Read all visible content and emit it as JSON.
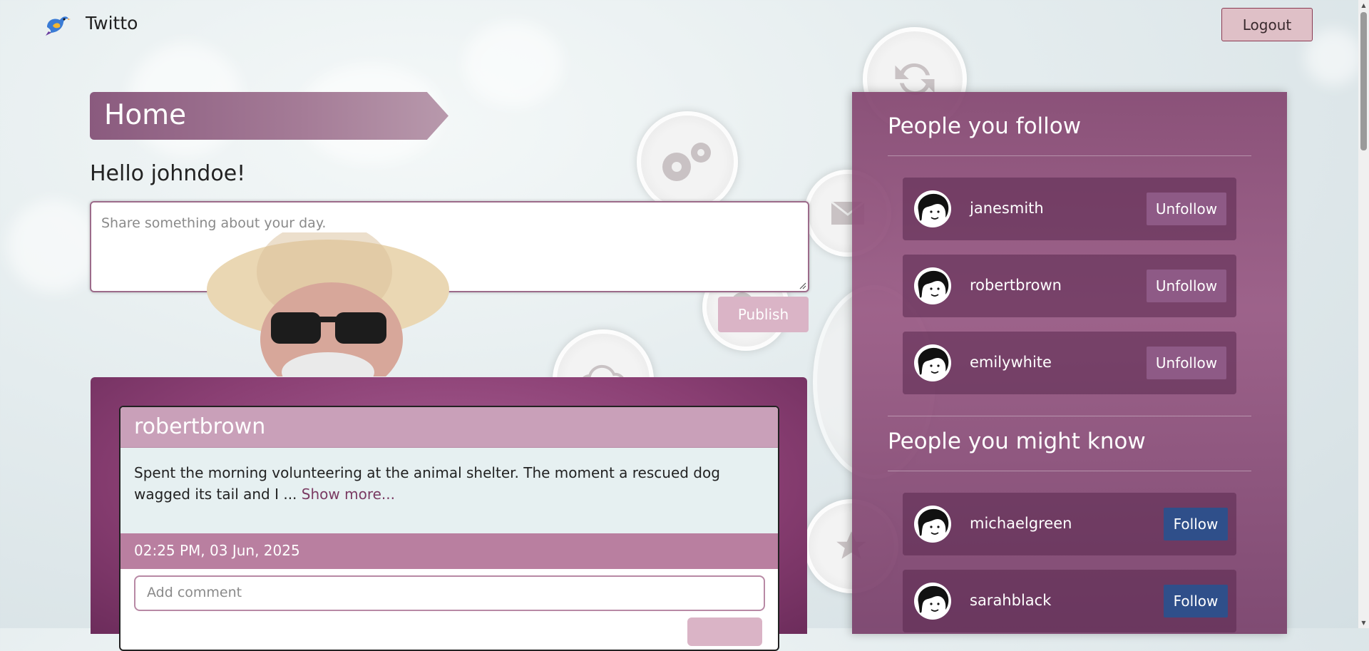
{
  "app": {
    "brand": "Twitto",
    "logout_label": "Logout"
  },
  "page": {
    "title": "Home",
    "greeting": "Hello johndoe!",
    "share_placeholder": "Share something about your day.",
    "publish_label": "Publish"
  },
  "feed": {
    "posts": [
      {
        "author": "robertbrown",
        "text": "Spent the morning volunteering at the animal shelter. The moment a rescued dog wagged its tail and I ... ",
        "show_more": "Show more...",
        "timestamp": "02:25 PM, 03 Jun, 2025",
        "comment_placeholder": "Add comment"
      }
    ]
  },
  "sidebar": {
    "following_title": "People you follow",
    "following": [
      {
        "name": "janesmith",
        "action": "Unfollow"
      },
      {
        "name": "robertbrown",
        "action": "Unfollow"
      },
      {
        "name": "emilywhite",
        "action": "Unfollow"
      }
    ],
    "suggest_title": "People you might know",
    "suggestions": [
      {
        "name": "michaelgreen",
        "action": "Follow"
      },
      {
        "name": "sarahblack",
        "action": "Follow"
      }
    ]
  },
  "colors": {
    "accent": "#8a3f73",
    "follow_button": "#2f4f8a",
    "unfollow_button": "#8e5a86",
    "publish_button": "#dab4c6"
  },
  "icons": [
    "bird-logo-icon",
    "refresh-icon",
    "gears-icon",
    "mail-icon",
    "search-icon",
    "cloud-icon",
    "star-icon",
    "avatar-icon",
    "resize-handle-icon",
    "scroll-up-icon",
    "scroll-down-icon"
  ]
}
